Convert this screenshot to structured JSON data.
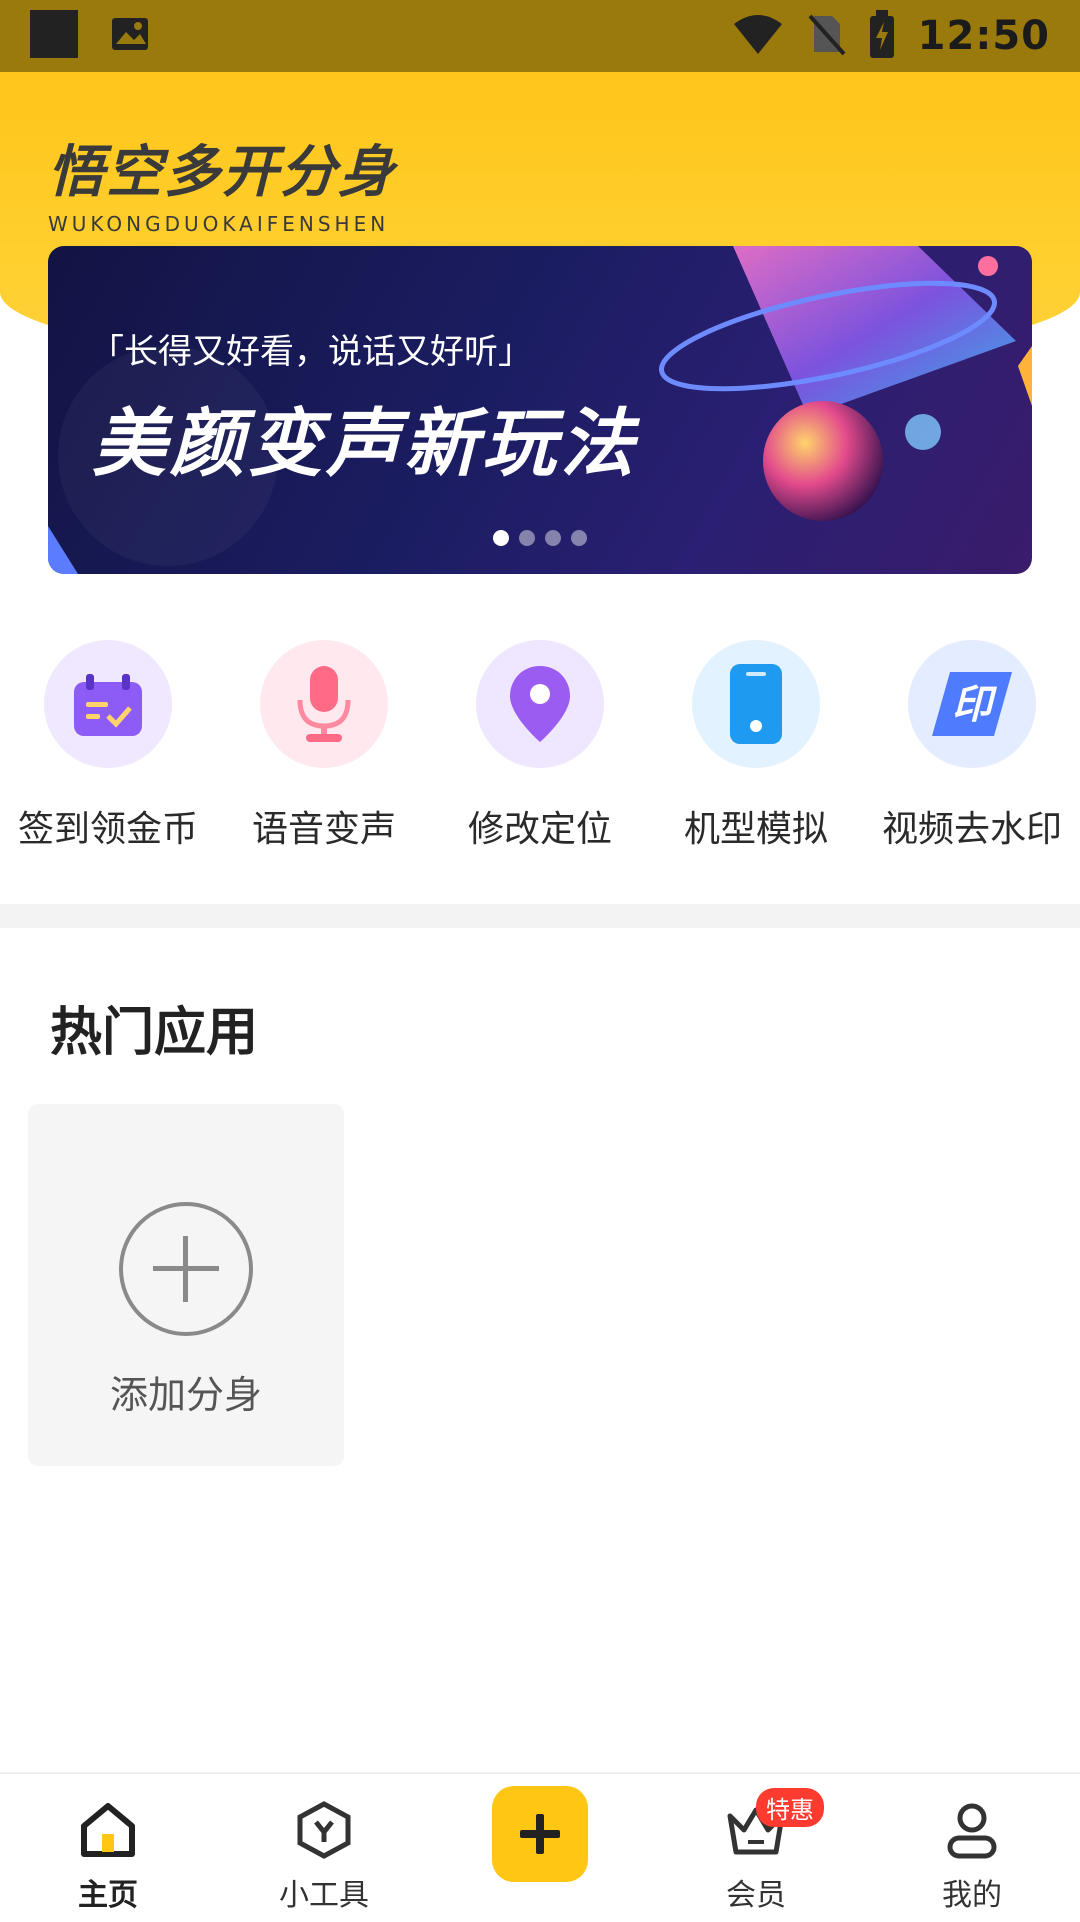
{
  "status_bar": {
    "time": "12:50"
  },
  "header": {
    "logo_cn": "悟空多开分身",
    "logo_en": "WUKONGDUOKAIFENSHEN"
  },
  "banner": {
    "subtitle": "「长得又好看，说话又好听」",
    "title": "美颜变声新玩法",
    "dots_count": 4,
    "active_dot": 1
  },
  "tools": [
    {
      "label": "签到领金币",
      "icon": "calendar-check-icon"
    },
    {
      "label": "语音变声",
      "icon": "microphone-icon"
    },
    {
      "label": "修改定位",
      "icon": "location-pin-icon"
    },
    {
      "label": "机型模拟",
      "icon": "phone-icon"
    },
    {
      "label": "视频去水印",
      "icon": "stamp-icon"
    }
  ],
  "section": {
    "title": "热门应用"
  },
  "add_card": {
    "label": "添加分身"
  },
  "bottom_nav": {
    "home": "主页",
    "tools": "小工具",
    "member": "会员",
    "member_badge": "特惠",
    "mine": "我的"
  },
  "colors": {
    "accent": "#ffc714",
    "header": "#ffcf2d",
    "statusbar": "#9a7a0c"
  }
}
